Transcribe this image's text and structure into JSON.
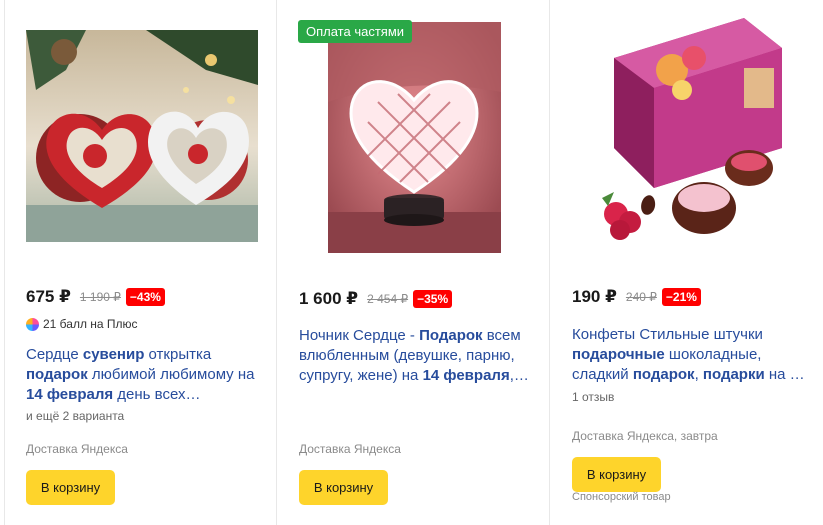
{
  "products": [
    {
      "image": "heart-gears-souvenir",
      "price": "675 ₽",
      "old_price": "1 190 ₽",
      "discount": "−43%",
      "plus_text": "21 балл на Плюс",
      "title_parts": [
        "Сердце ",
        "сувенир",
        " открытка ",
        "подарок",
        " любимой любимому на ",
        "14 февраля",
        " день всех…"
      ],
      "variants": "и ещё 2 варианта",
      "delivery": "Доставка Яндекса",
      "cart_label": "В корзину"
    },
    {
      "image": "heart-night-lamp",
      "badge": "Оплата частями",
      "price": "1 600 ₽",
      "old_price": "2 454 ₽",
      "discount": "−35%",
      "title_parts": [
        "Ночник Сердце - ",
        "Подарок",
        " всем влюбленным (девушке, парню, супругу, жене) на ",
        "14 февраля",
        ",…"
      ],
      "delivery": "Доставка Яндекса",
      "cart_label": "В корзину"
    },
    {
      "image": "chocolate-box",
      "price": "190 ₽",
      "old_price": "240 ₽",
      "discount": "−21%",
      "title_parts": [
        "Конфеты Стильные штучки ",
        "подарочные",
        " шоколадные, сладкий ",
        "подарок",
        ", ",
        "подарки",
        " на …"
      ],
      "reviews": "1 отзыв",
      "delivery": "Доставка Яндекса, завтра",
      "cart_label": "В корзину",
      "sponsor": "Спонсорский товар"
    }
  ],
  "colors": {
    "link": "#274c9c",
    "discount_bg": "#ff0000",
    "cart_button": "#fed42b",
    "pay_badge": "#2aa847"
  }
}
